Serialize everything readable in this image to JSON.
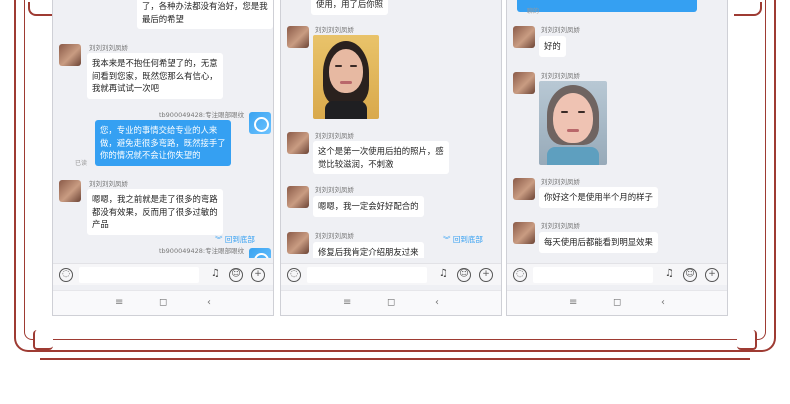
{
  "colors": {
    "frame": "#9e3b33",
    "bubble_blue": "#35a0f2",
    "bubble_white": "#ffffff",
    "chat_bg": "#eff0f4"
  },
  "icons": {
    "voice": "voice-icon",
    "mic": "mic-icon",
    "emoji": "emoji-icon",
    "plus": "plus-icon",
    "menu": "menu-icon",
    "home": "home-icon",
    "back": "back-icon",
    "chevron": "chevron-down-icon"
  },
  "phone1": {
    "msg_top": "了，各种办法都没有治好，您是我\n最后的希望",
    "sender_a": "刘刘刘刘凤娇",
    "msg_a": "我本来是不抱任何希望了的，无意\n间看到您家，既然您那么有信心，\n我就再试试一次吧",
    "sender_me": "tb900049428:专注眼部眼纹",
    "msg_me": "您，专业的事情交给专业的人来\n做，避免走很多弯路，既然接手了\n你的情况就不会让你失望的",
    "read": "已读",
    "sender_b": "刘刘刘刘凤娇",
    "msg_b": "嗯嗯，我之前就是走了很多的弯路\n都没有效果，反而用了很多过敏的\n产品",
    "scroll_tip": "回到底部",
    "sender_me2": "tb900049428:专注眼部眼纹"
  },
  "phone2": {
    "msg_top": "使用，用了后你照",
    "sender_a": "刘刘刘刘凤娇",
    "sender_b": "刘刘刘刘凤娇",
    "msg_b": "这个是第一次使用后拍的照片，感\n觉比较滋润，不刺激",
    "sender_c": "刘刘刘刘凤娇",
    "msg_c": "嗯嗯，我一定会好好配合的",
    "sender_d": "刘刘刘刘凤娇",
    "msg_d": "修复后我肯定介绍朋友过来",
    "scroll_tip": "回到底部"
  },
  "phone3": {
    "msg_top": "聊的",
    "sender_a": "刘刘刘刘凤娇",
    "msg_a": "好的",
    "sender_b": "刘刘刘刘凤娇",
    "sender_c": "刘刘刘刘凤娇",
    "msg_c": "你好这个是使用半个月的样子",
    "sender_d": "刘刘刘刘凤娇",
    "msg_d": "每天使用后都能看到明显效果"
  },
  "nav": {
    "menu": "≡",
    "home": "◻",
    "back": "‹"
  }
}
